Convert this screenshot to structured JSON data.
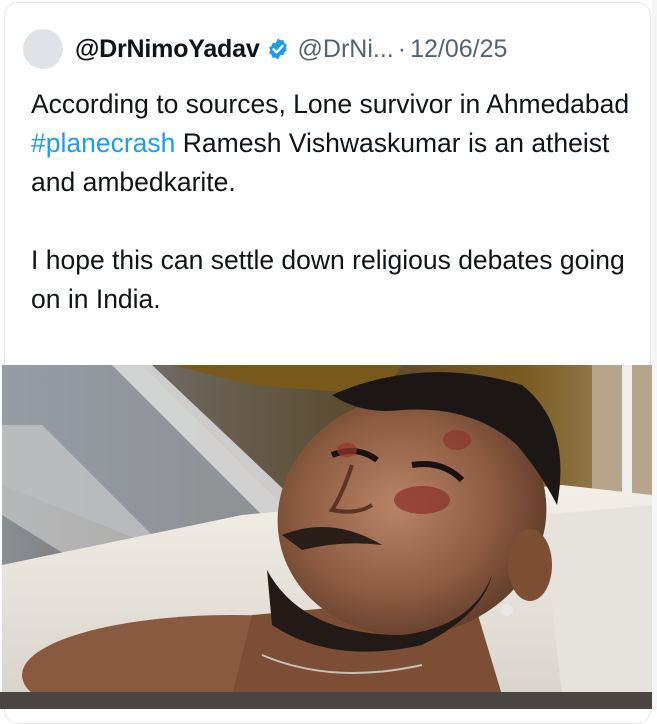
{
  "tweet": {
    "display_name": "@DrNimoYadav",
    "handle": "@DrNi...",
    "separator": "·",
    "date": "12/06/25",
    "paragraph1_before": "According to sources, Lone survivor in Ahmedabad ",
    "hashtag": "#planecrash",
    "paragraph1_after": " Ramesh Vishwaskumar is an atheist and ambedkarite.",
    "paragraph2": "I hope this can settle down religious debates going on in India."
  },
  "icons": {
    "verified": "verified-badge-icon",
    "avatar": "avatar"
  },
  "colors": {
    "link": "#1d9bf0",
    "verified": "#1d9bf0",
    "secondary_text": "#536471",
    "primary_text": "#0f1419"
  }
}
